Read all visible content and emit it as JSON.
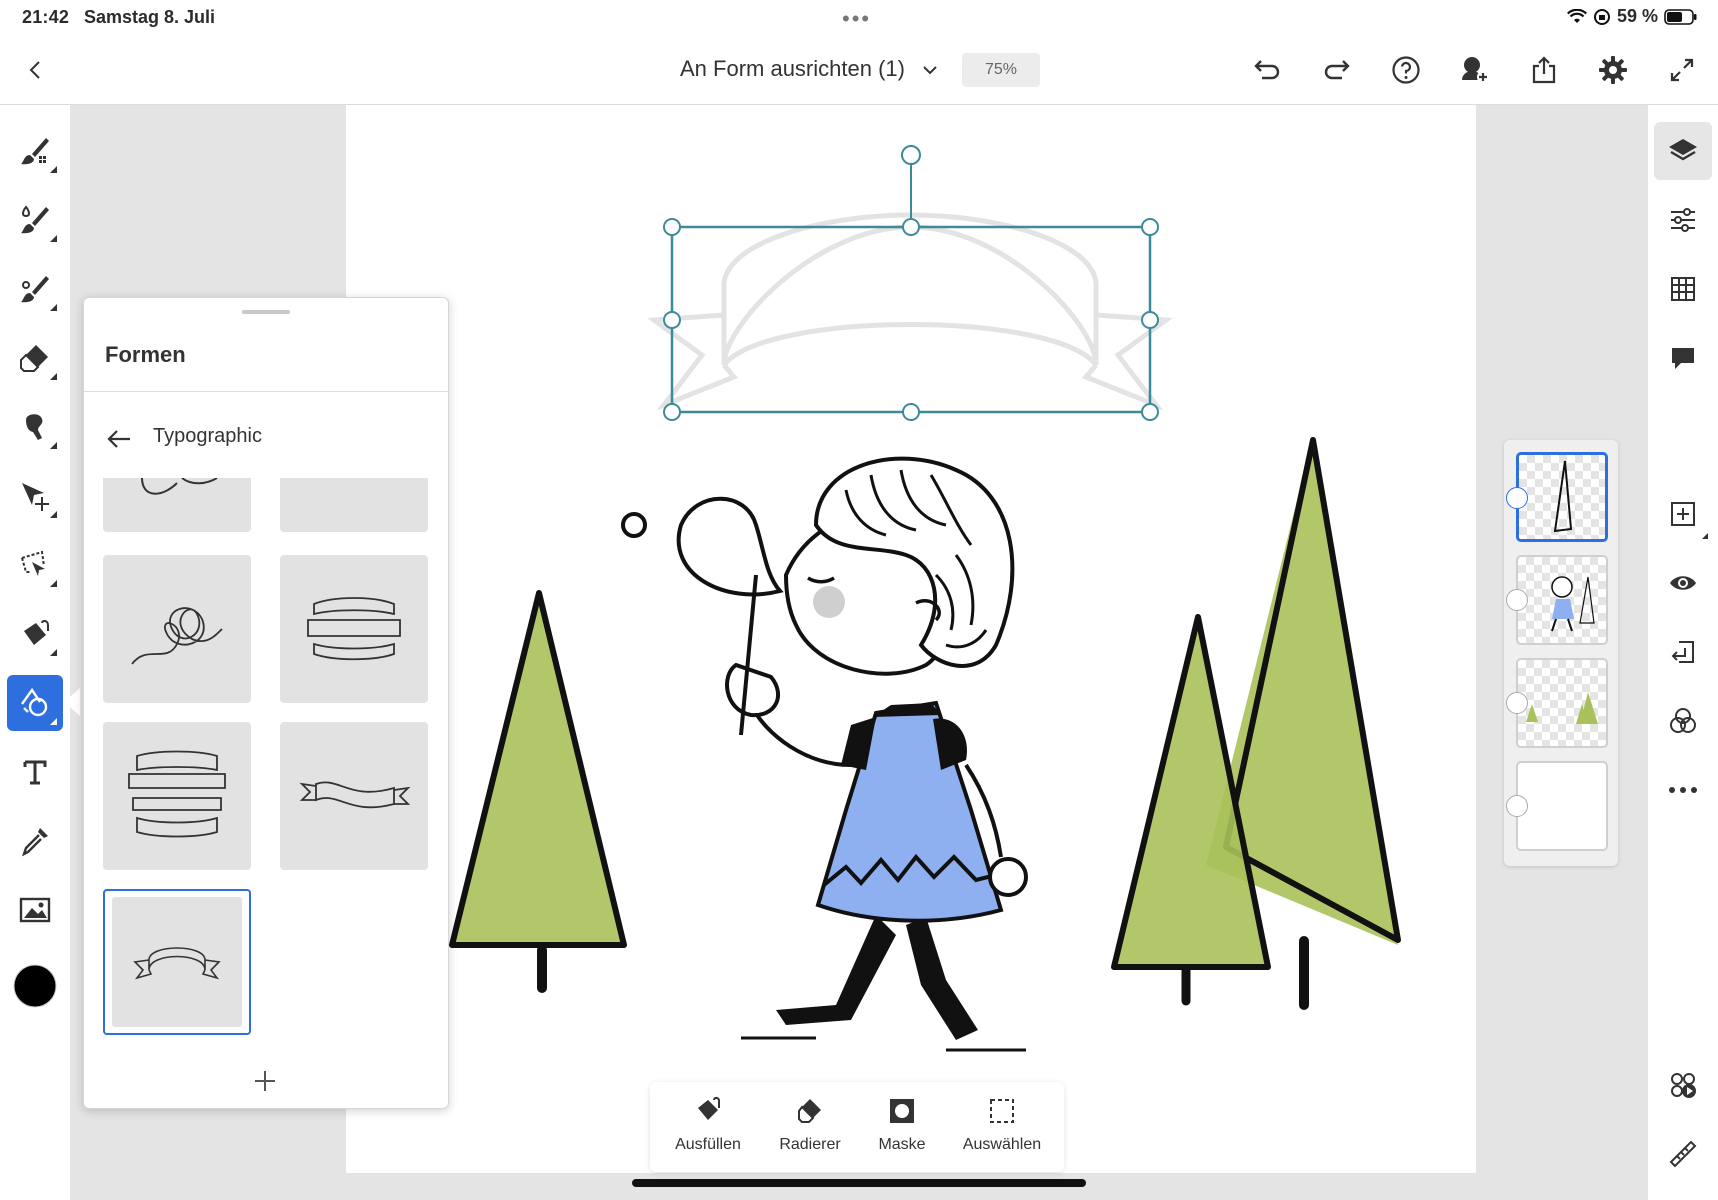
{
  "status_bar": {
    "time": "21:42",
    "date": "Samstag 8. Juli",
    "battery": "59 %",
    "more_dots": "•••"
  },
  "top_bar": {
    "document_title": "An Form ausrichten (1)",
    "zoom": "75%",
    "icons": [
      "back-icon",
      "chevron-down-icon",
      "undo-icon",
      "redo-icon",
      "help-icon",
      "invite-icon",
      "share-icon",
      "settings-icon",
      "fullscreen-icon"
    ]
  },
  "left_tools": [
    "pixel-brush-icon",
    "live-brush-icon",
    "vector-brush-icon",
    "eraser-icon",
    "smudge-icon",
    "transform-icon",
    "lasso-icon",
    "fill-icon",
    "shapes-icon",
    "text-icon",
    "eyedropper-icon",
    "image-icon",
    "color-swatch"
  ],
  "active_tool": "shapes-icon",
  "color": {
    "swatch": "#000000",
    "accent": "#2d6fde",
    "selection": "#3d8a9a",
    "tree_green": "#a9c15a",
    "dress_blue": "#8fb0f0"
  },
  "shapes_panel": {
    "title": "Formen",
    "category": "Typographic",
    "add_label": "+"
  },
  "right_tools": [
    "layers-icon",
    "adjustments-icon",
    "grid-icon",
    "comments-icon",
    "add-layer-icon",
    "visibility-icon",
    "merge-down-icon",
    "blend-mode-icon",
    "more-icon",
    "timelapse-icon",
    "ruler-icon"
  ],
  "layers": [
    {
      "name": "shape-layer",
      "selected": true
    },
    {
      "name": "character-layer",
      "selected": false
    },
    {
      "name": "trees-layer",
      "selected": false
    },
    {
      "name": "background-layer",
      "selected": false
    }
  ],
  "action_bar": {
    "fill": "Ausfüllen",
    "eraser": "Radierer",
    "mask": "Maske",
    "select": "Auswählen"
  }
}
